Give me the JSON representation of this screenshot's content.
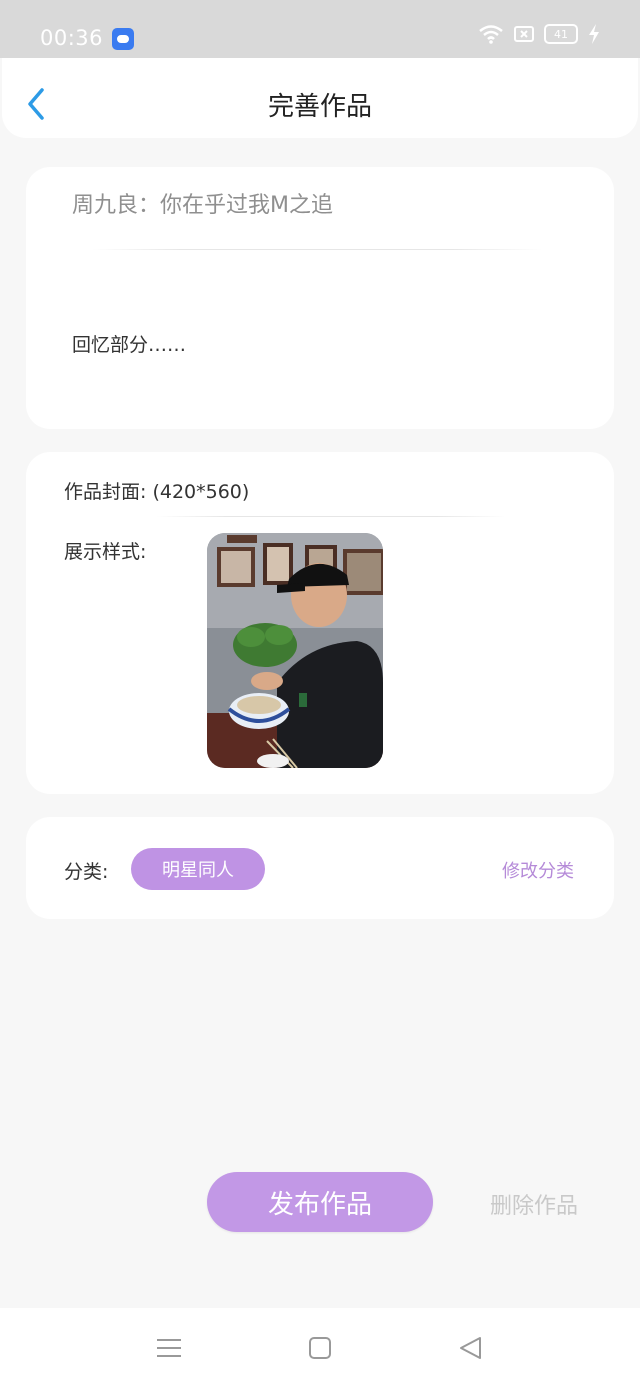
{
  "status_bar": {
    "time": "00:36",
    "battery": "41"
  },
  "header": {
    "title": "完善作品"
  },
  "editor": {
    "title": "周九良：你在乎过我M之追",
    "content": "回忆部分……"
  },
  "cover": {
    "label": "作品封面: (420*560)",
    "style_label": "展示样式:"
  },
  "category": {
    "label": "分类:",
    "tag": "明星同人",
    "edit": "修改分类"
  },
  "actions": {
    "publish": "发布作品",
    "delete": "删除作品"
  },
  "colors": {
    "accent": "#c298e6",
    "back_icon": "#2d9be6",
    "background": "#f7f7f7"
  }
}
